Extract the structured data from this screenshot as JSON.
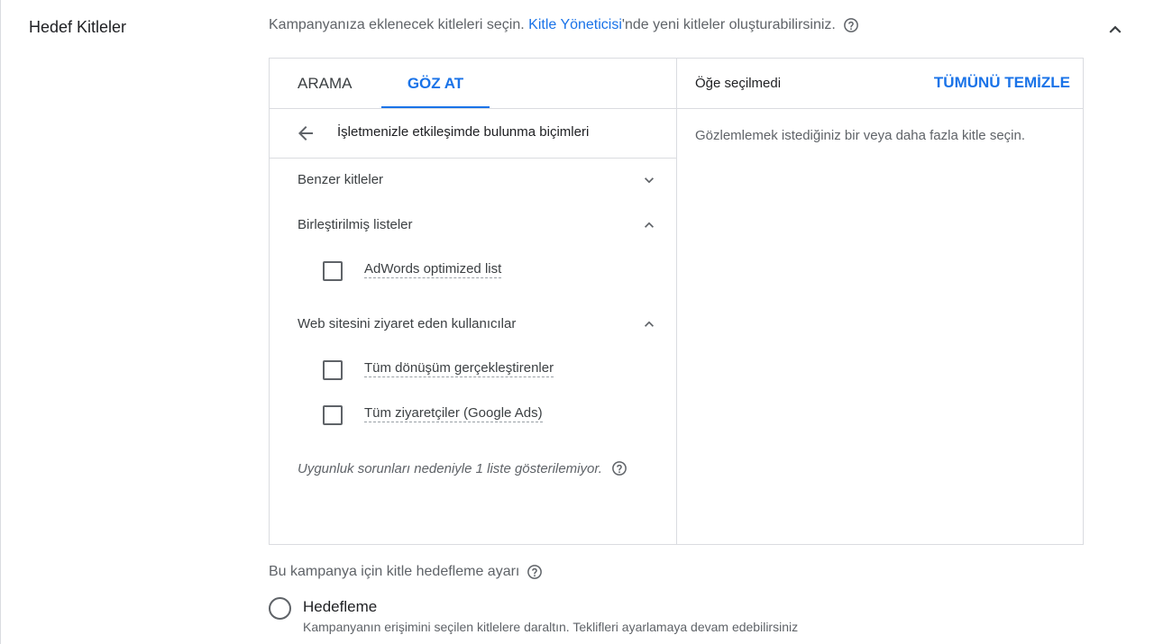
{
  "section": {
    "title": "Hedef Kitleler",
    "intro_before": "Kampanyanıza eklenecek kitleleri seçin.",
    "intro_link": "Kitle Yöneticisi",
    "intro_after": "'nde yeni kitleler oluşturabilirsiniz."
  },
  "tabs": {
    "search": "ARAMA",
    "browse": "GÖZ AT",
    "active": "browse"
  },
  "breadcrumb": {
    "label": "İşletmenizle etkileşimde bulunma biçimleri"
  },
  "categories": [
    {
      "label": "Benzer kitleler",
      "expanded": false
    },
    {
      "label": "Birleştirilmiş listeler",
      "expanded": true,
      "options": [
        {
          "label": "AdWords optimized list",
          "checked": false
        }
      ]
    },
    {
      "label": "Web sitesini ziyaret eden kullanıcılar",
      "expanded": true,
      "options": [
        {
          "label": "Tüm dönüşüm gerçekleştirenler",
          "checked": false
        },
        {
          "label": "Tüm ziyaretçiler (Google Ads)",
          "checked": false
        }
      ]
    }
  ],
  "notice": "Uygunluk sorunları nedeniyle 1 liste gösterilemiyor.",
  "selection": {
    "status": "Öğe seçilmedi",
    "clear_all": "TÜMÜNÜ TEMİZLE",
    "empty_message": "Gözlemlemek istediğiniz bir veya daha fazla kitle seçin."
  },
  "targeting": {
    "label": "Bu kampanya için kitle hedefleme ayarı",
    "option_label": "Hedefleme",
    "option_desc": "Kampanyanın erişimini seçilen kitlelere daraltın. Teklifleri ayarlamaya devam edebilirsiniz",
    "selected": false
  },
  "colors": {
    "accent": "#1a73e8",
    "border": "#dadce0",
    "text": "#3c4043",
    "muted": "#5f6368"
  }
}
